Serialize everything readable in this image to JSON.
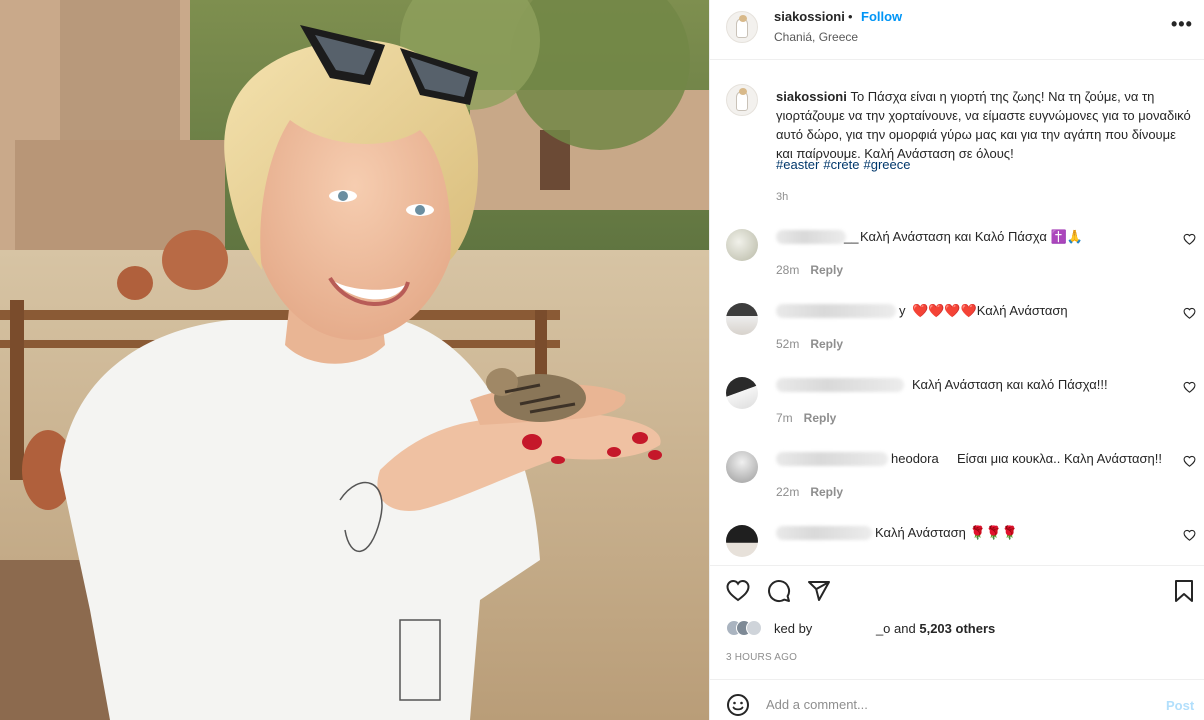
{
  "post": {
    "username": "siakossioni",
    "separator": "•",
    "follow_label": "Follow",
    "location": "Chaniá, Greece",
    "more_icon": "more-horizontal-icon"
  },
  "caption": {
    "username": "siakossioni",
    "text": "Το Πάσχα είναι η γιορτή της ζωης! Να τη ζούμε, να τη γιορτάζουμε να την χορταίνουνε, να είμαστε ευγνώμονες για το μοναδικό αυτό δώρο, για την ομορφιά γύρω μας και για την αγάπη που δίνουμε και παίρνουμε. Καλή Ανάσταση σε όλους!",
    "hashtags": [
      "#easter",
      "#crete",
      "#greece"
    ],
    "time": "3h"
  },
  "comments": [
    {
      "username_fragment": "__",
      "text": "Καλή Ανάσταση και Καλό Πάσχα ✝️🙏",
      "time": "28m",
      "reply_label": "Reply"
    },
    {
      "username_fragment": "y",
      "text": "❤️❤️❤️❤️Καλή Ανάσταση",
      "time": "52m",
      "reply_label": "Reply"
    },
    {
      "username_fragment": "",
      "text": "Καλή Ανάσταση και καλό Πάσχα!!!",
      "time": "7m",
      "reply_label": "Reply"
    },
    {
      "username_fragment": "heodora",
      "text": "Είσαι μια κουκλα.. Καλη Ανάσταση!!",
      "time": "22m",
      "reply_label": "Reply"
    },
    {
      "username_fragment": "",
      "text": "Καλή Ανάσταση 🌹🌹🌹",
      "time": "",
      "reply_label": ""
    }
  ],
  "likes": {
    "prefix_fragment": "ked by",
    "liker_fragment": "_o",
    "conjunction": "and",
    "count_text": "5,203 others"
  },
  "posted_ago": "3 HOURS AGO",
  "add_comment": {
    "placeholder": "Add a comment...",
    "post_label": "Post"
  },
  "colors": {
    "accent": "#0095f6",
    "post_disabled": "#b2dffc",
    "hashtag": "#00376b",
    "muted": "#8e8e8e"
  }
}
